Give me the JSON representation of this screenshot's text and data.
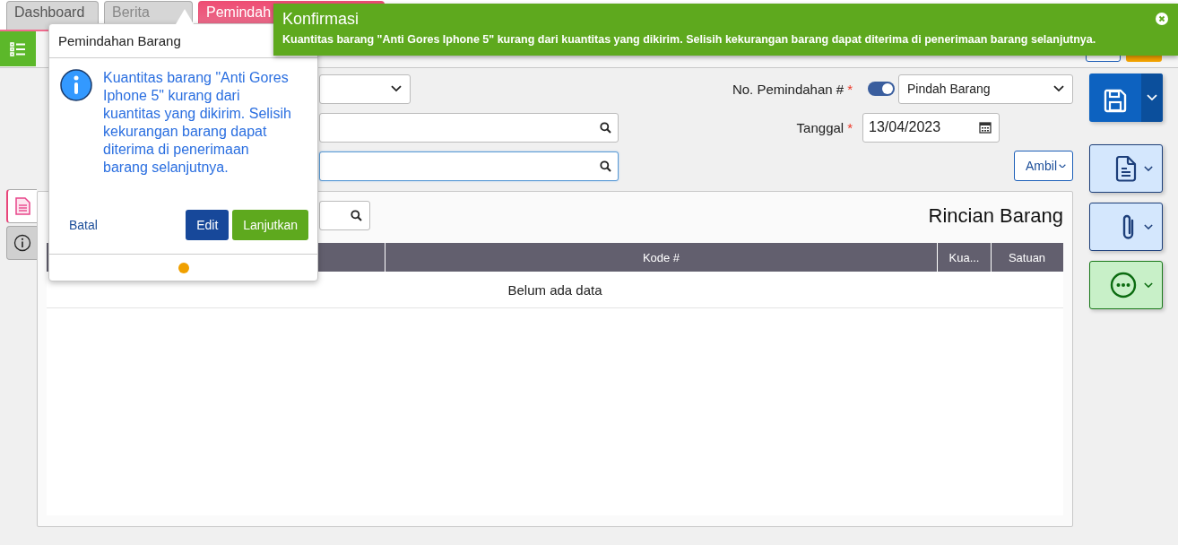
{
  "tabs": [
    {
      "label": "Dashboard",
      "selected": false
    },
    {
      "label": "Berita",
      "selected": false
    },
    {
      "label": "Pemindah",
      "selected": true
    }
  ],
  "form": {
    "transfer_no": {
      "label": "No. Pemindahan #",
      "mark": "*",
      "auto_number": true,
      "value": "Pindah Barang"
    },
    "date": {
      "label": "Tanggal",
      "mark": "*",
      "value": "13/04/2023"
    },
    "fetch_button": "Ambil"
  },
  "side_tabs": [
    {
      "kind": "document",
      "selected": true
    },
    {
      "kind": "info",
      "selected": false
    }
  ],
  "rail_buttons": [
    {
      "kind": "save"
    },
    {
      "kind": "document"
    },
    {
      "kind": "attachment"
    },
    {
      "kind": "more"
    }
  ],
  "details": {
    "title": "Rincian Barang",
    "columns": [
      "Kode #",
      "Kua...",
      "Satuan"
    ],
    "empty_text": "Belum ada data"
  },
  "popover": {
    "title": "Pemindahan Barang",
    "message": "Kuantitas barang \"Anti Gores Iphone 5\" kurang dari kuantitas yang dikirim. Selisih kekurangan barang dapat diterima di penerimaan barang selanjutnya.",
    "buttons": [
      {
        "label": "Batal",
        "kind": "link"
      },
      {
        "label": "Edit",
        "kind": "primary"
      },
      {
        "label": "Lanjutkan",
        "kind": "success"
      }
    ]
  },
  "toast": {
    "title": "Konfirmasi",
    "message": "Kuantitas barang \"Anti Gores Iphone 5\" kurang dari kuantitas yang dikirim. Selisih kekurangan barang dapat diterima di penerimaan barang selanjutnya."
  }
}
